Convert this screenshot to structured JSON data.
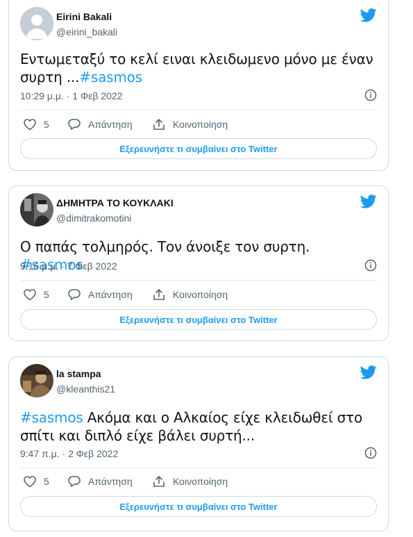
{
  "colors": {
    "accent": "#1d9bf0",
    "text": "#0f1419",
    "muted": "#536471",
    "border": "#cfd9de"
  },
  "tweets": [
    {
      "name": "Eirini Bakali",
      "handle": "@eirini_bakali",
      "text_before": "Εντωμεταξύ το κελί ειναι κλειδωμενο μόνο με έναν συρτη ...",
      "hashtag": "#sasmos",
      "text_after": "",
      "timestamp": "10:29 μ.μ. · 1 Φεβ 2022",
      "likes": "5",
      "reply_label": "Απάντηση",
      "share_label": "Κοινοποίηση",
      "explore_label": "Εξερευνήστε τι συμβαίνει στο Twitter",
      "avatar": "default-avatar-icon"
    },
    {
      "name": "ΔΗΜΗΤΡΑ ΤΟ ΚΟΥΚΛΑΚΙ",
      "handle": "@dimitrakomotini",
      "text_before": "Ο παπάς τολμηρός. Τον άνοιξε τον συρτη. ",
      "hashtag": "#sasmos",
      "text_after": "",
      "timestamp": "9:16 μ.μ. · 7 Φεβ 2022",
      "likes": "5",
      "reply_label": "Απάντηση",
      "share_label": "Κοινοποίηση",
      "explore_label": "Εξερευνήστε τι συμβαίνει στο Twitter",
      "avatar": "photo-avatar-grayscale"
    },
    {
      "name": "la stampa",
      "handle": "@kleanthis21",
      "text_before": "",
      "hashtag": "#sasmos",
      "text_after": " Ακόμα και ο Αλκαίος είχε κλειδωθεί στο σπίτι και διπλό είχε βάλει συρτή...",
      "timestamp": "9:47 π.μ. · 2 Φεβ 2022",
      "likes": "5",
      "reply_label": "Απάντηση",
      "share_label": "Κοινοποίηση",
      "explore_label": "Εξερευνήστε τι συμβαίνει στο Twitter",
      "avatar": "photo-avatar-sepia"
    }
  ]
}
